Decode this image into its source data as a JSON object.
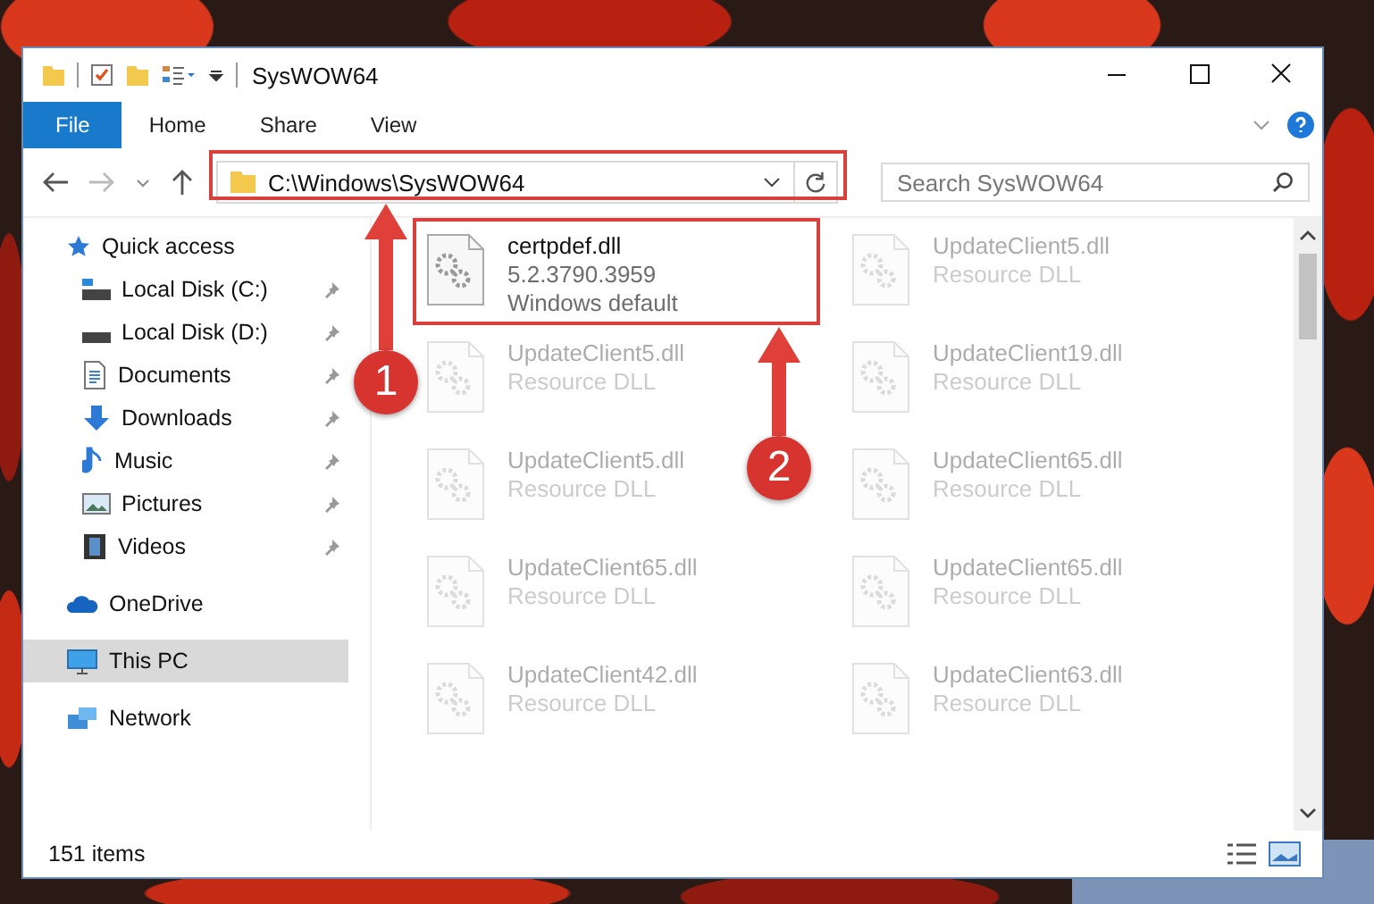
{
  "window": {
    "title": "SysWOW64"
  },
  "ribbon": {
    "tabs": [
      {
        "label": "File",
        "kind": "file",
        "selected": false
      },
      {
        "label": "Home",
        "kind": "tab",
        "selected": false
      },
      {
        "label": "Share",
        "kind": "tab",
        "selected": false
      },
      {
        "label": "View",
        "kind": "tab",
        "selected": false
      }
    ]
  },
  "address_bar": {
    "path": "C:\\Windows\\SysWOW64"
  },
  "search": {
    "placeholder": "Search SysWOW64"
  },
  "sidebar": {
    "items": [
      {
        "label": "Quick access",
        "kind": "quick",
        "selected": false,
        "children": [
          {
            "label": "Local Disk (C:)",
            "kind": "drive-c",
            "pinned": true,
            "selected": false
          },
          {
            "label": "Local Disk (D:)",
            "kind": "drive",
            "pinned": true,
            "selected": false
          },
          {
            "label": "Documents",
            "kind": "documents",
            "pinned": true,
            "selected": false
          },
          {
            "label": "Downloads",
            "kind": "downloads",
            "pinned": true,
            "selected": false
          },
          {
            "label": "Music",
            "kind": "music",
            "pinned": true,
            "selected": false
          },
          {
            "label": "Pictures",
            "kind": "pictures",
            "pinned": true,
            "selected": false
          },
          {
            "label": "Videos",
            "kind": "videos",
            "pinned": true,
            "selected": false
          }
        ]
      },
      {
        "label": "OneDrive",
        "kind": "onedrive",
        "selected": false
      },
      {
        "label": "This PC",
        "kind": "pc",
        "selected": true
      },
      {
        "label": "Network",
        "kind": "network",
        "selected": false
      }
    ]
  },
  "files": [
    {
      "name": "certpdef.dll",
      "details": [
        "5.2.3790.3959",
        "Windows default"
      ],
      "blurred": false
    },
    {
      "name": "UpdateClient5.dll",
      "details": [
        "Resource DLL"
      ],
      "blurred": true
    },
    {
      "name": "UpdateClient5.dll",
      "details": [
        "Resource DLL"
      ],
      "blurred": true
    },
    {
      "name": "UpdateClient19.dll",
      "details": [
        "Resource DLL"
      ],
      "blurred": true
    },
    {
      "name": "UpdateClient5.dll",
      "details": [
        "Resource DLL"
      ],
      "blurred": true
    },
    {
      "name": "UpdateClient65.dll",
      "details": [
        "Resource DLL"
      ],
      "blurred": true
    },
    {
      "name": "UpdateClient65.dll",
      "details": [
        "Resource DLL"
      ],
      "blurred": true
    },
    {
      "name": "UpdateClient65.dll",
      "details": [
        "Resource DLL"
      ],
      "blurred": true
    },
    {
      "name": "UpdateClient42.dll",
      "details": [
        "Resource DLL"
      ],
      "blurred": true
    },
    {
      "name": "UpdateClient63.dll",
      "details": [
        "Resource DLL"
      ],
      "blurred": true
    }
  ],
  "annotations": [
    {
      "label": "1"
    },
    {
      "label": "2"
    }
  ],
  "status_bar": {
    "item_count": "151 items"
  }
}
